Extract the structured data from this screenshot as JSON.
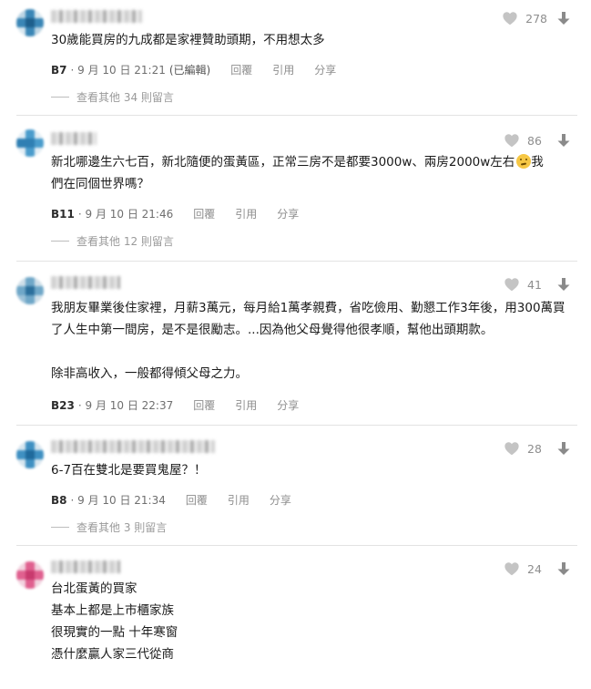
{
  "colors": {
    "accent": "#333333",
    "muted": "#8e8e8e"
  },
  "icons": {
    "like": "heart-icon",
    "dislike": "arrow-down-icon"
  },
  "comments": [
    {
      "likes": "278",
      "text": "30歲能買房的九成都是家裡贊助頭期，不用想太多",
      "floor": "B7",
      "date": "· 9 月 10 日 21:21",
      "edited": "(已編輯)",
      "reply": "回覆",
      "quote": "引用",
      "share": "分享",
      "more": "查看其他 34 則留言"
    },
    {
      "likes": "86",
      "text_a": "新北哪邊生六七百，新北隨便的蛋黃區，正常三房不是都要3000w、兩房2000w左右",
      "text_b": "我",
      "text_c": "們在同個世界嗎？",
      "floor": "B11",
      "date": "· 9 月 10 日 21:46",
      "reply": "回覆",
      "quote": "引用",
      "share": "分享",
      "more": "查看其他 12 則留言"
    },
    {
      "likes": "41",
      "text": "我朋友畢業後住家裡，月薪3萬元，每月給1萬孝親費，省吃儉用、勤懇工作3年後，用300萬買了人生中第一間房，是不是很勵志。...因為他父母覺得他很孝順，幫他出頭期款。\n\n除非高收入，一般都得傾父母之力。",
      "floor": "B23",
      "date": "· 9 月 10 日 22:37",
      "reply": "回覆",
      "quote": "引用",
      "share": "分享"
    },
    {
      "likes": "28",
      "text": "6-7百在雙北是要買鬼屋？！",
      "floor": "B8",
      "date": "· 9 月 10 日 21:34",
      "reply": "回覆",
      "quote": "引用",
      "share": "分享",
      "more": "查看其他 3 則留言"
    },
    {
      "likes": "24",
      "text": "台北蛋黃的買家\n基本上都是上市櫃家族\n很現實的一點 十年寒窗\n憑什麼贏人家三代從商"
    }
  ]
}
